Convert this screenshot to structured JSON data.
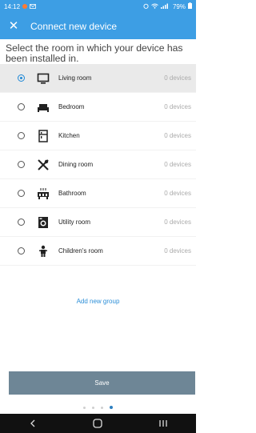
{
  "status_bar": {
    "time": "14:12",
    "right_icons": [
      "alarm-icon",
      "wifi-icon",
      "signal-icon",
      "battery-icon"
    ],
    "battery": "79%"
  },
  "app_bar": {
    "close_icon": "close-icon",
    "title": "Connect new device"
  },
  "instruction": "Select the room in which your device has been installed in.",
  "rooms": [
    {
      "label": "Living room",
      "count": "0 devices",
      "icon": "tv-icon",
      "selected": true
    },
    {
      "label": "Bedroom",
      "count": "0 devices",
      "icon": "bed-icon",
      "selected": false
    },
    {
      "label": "Kitchen",
      "count": "0 devices",
      "icon": "fridge-icon",
      "selected": false
    },
    {
      "label": "Dining room",
      "count": "0 devices",
      "icon": "cutlery-icon",
      "selected": false
    },
    {
      "label": "Bathroom",
      "count": "0 devices",
      "icon": "bathtub-icon",
      "selected": false
    },
    {
      "label": "Utility room",
      "count": "0 devices",
      "icon": "washing-machine-icon",
      "selected": false
    },
    {
      "label": "Children's room",
      "count": "0 devices",
      "icon": "child-icon",
      "selected": false
    }
  ],
  "add_group_label": "Add new group",
  "save_label": "Save",
  "pager": {
    "total": 4,
    "active": 4
  },
  "colors": {
    "accent": "#3d9ee4",
    "save_bg": "#6e8696",
    "link": "#2d8fd8"
  }
}
